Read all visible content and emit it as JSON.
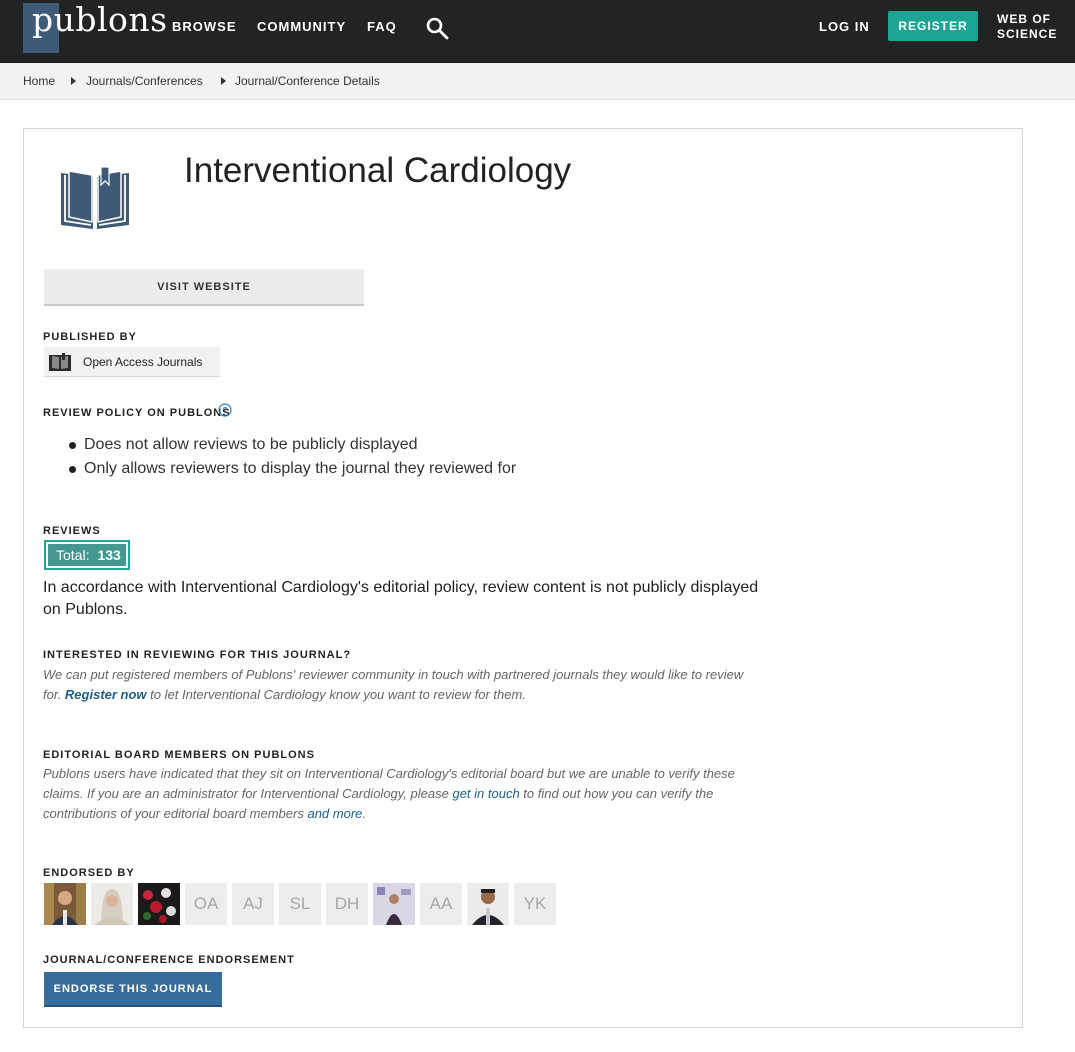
{
  "header": {
    "logo_text": "publons",
    "nav": [
      "BROWSE",
      "COMMUNITY",
      "FAQ"
    ],
    "login_label": "LOG IN",
    "register_label": "REGISTER",
    "wos_line1": "WEB OF",
    "wos_line2": "SCIENCE",
    "colors": {
      "bar": "#232323",
      "register": "#1aa595",
      "logo": "#3e5a76"
    }
  },
  "breadcrumb": [
    "Home",
    "Journals/Conferences",
    "Journal/Conference Details"
  ],
  "journal": {
    "title": "Interventional Cardiology",
    "visit_label": "VISIT WEBSITE"
  },
  "published_by": {
    "label": "PUBLISHED BY",
    "publisher": "Open Access Journals"
  },
  "review_policy": {
    "label": "REVIEW POLICY ON PUBLONS",
    "items": [
      "Does not allow reviews to be publicly displayed",
      "Only allows reviewers to display the journal they reviewed for"
    ]
  },
  "reviews": {
    "label": "REVIEWS",
    "total_label": "Total:",
    "total_value": "133",
    "text": "In accordance with Interventional Cardiology's editorial policy, review content is not publicly displayed on Publons."
  },
  "interested": {
    "label": "INTERESTED IN REVIEWING FOR THIS JOURNAL?",
    "text_before": "We can put registered members of Publons' reviewer community in touch with partnered journals they would like to review for. ",
    "link": "Register now",
    "text_after": " to let Interventional Cardiology know you want to review for them."
  },
  "editorial": {
    "label": "EDITORIAL BOARD MEMBERS ON PUBLONS",
    "text_before": "Publons users have indicated that they sit on Interventional Cardiology's editorial board but we are unable to verify these claims. If you are an administrator for Interventional Cardiology, please ",
    "link1": "get in touch",
    "text_middle": " to find out how you can verify the contributions of your editorial board members ",
    "link2": "and more",
    "text_end": "."
  },
  "endorsed": {
    "label": "ENDORSED BY",
    "initials": [
      "OA",
      "AJ",
      "SL",
      "DH",
      "AA",
      "YK"
    ]
  },
  "endorsement": {
    "label": "JOURNAL/CONFERENCE ENDORSEMENT",
    "button": "ENDORSE THIS JOURNAL",
    "color": "#386d9b"
  }
}
